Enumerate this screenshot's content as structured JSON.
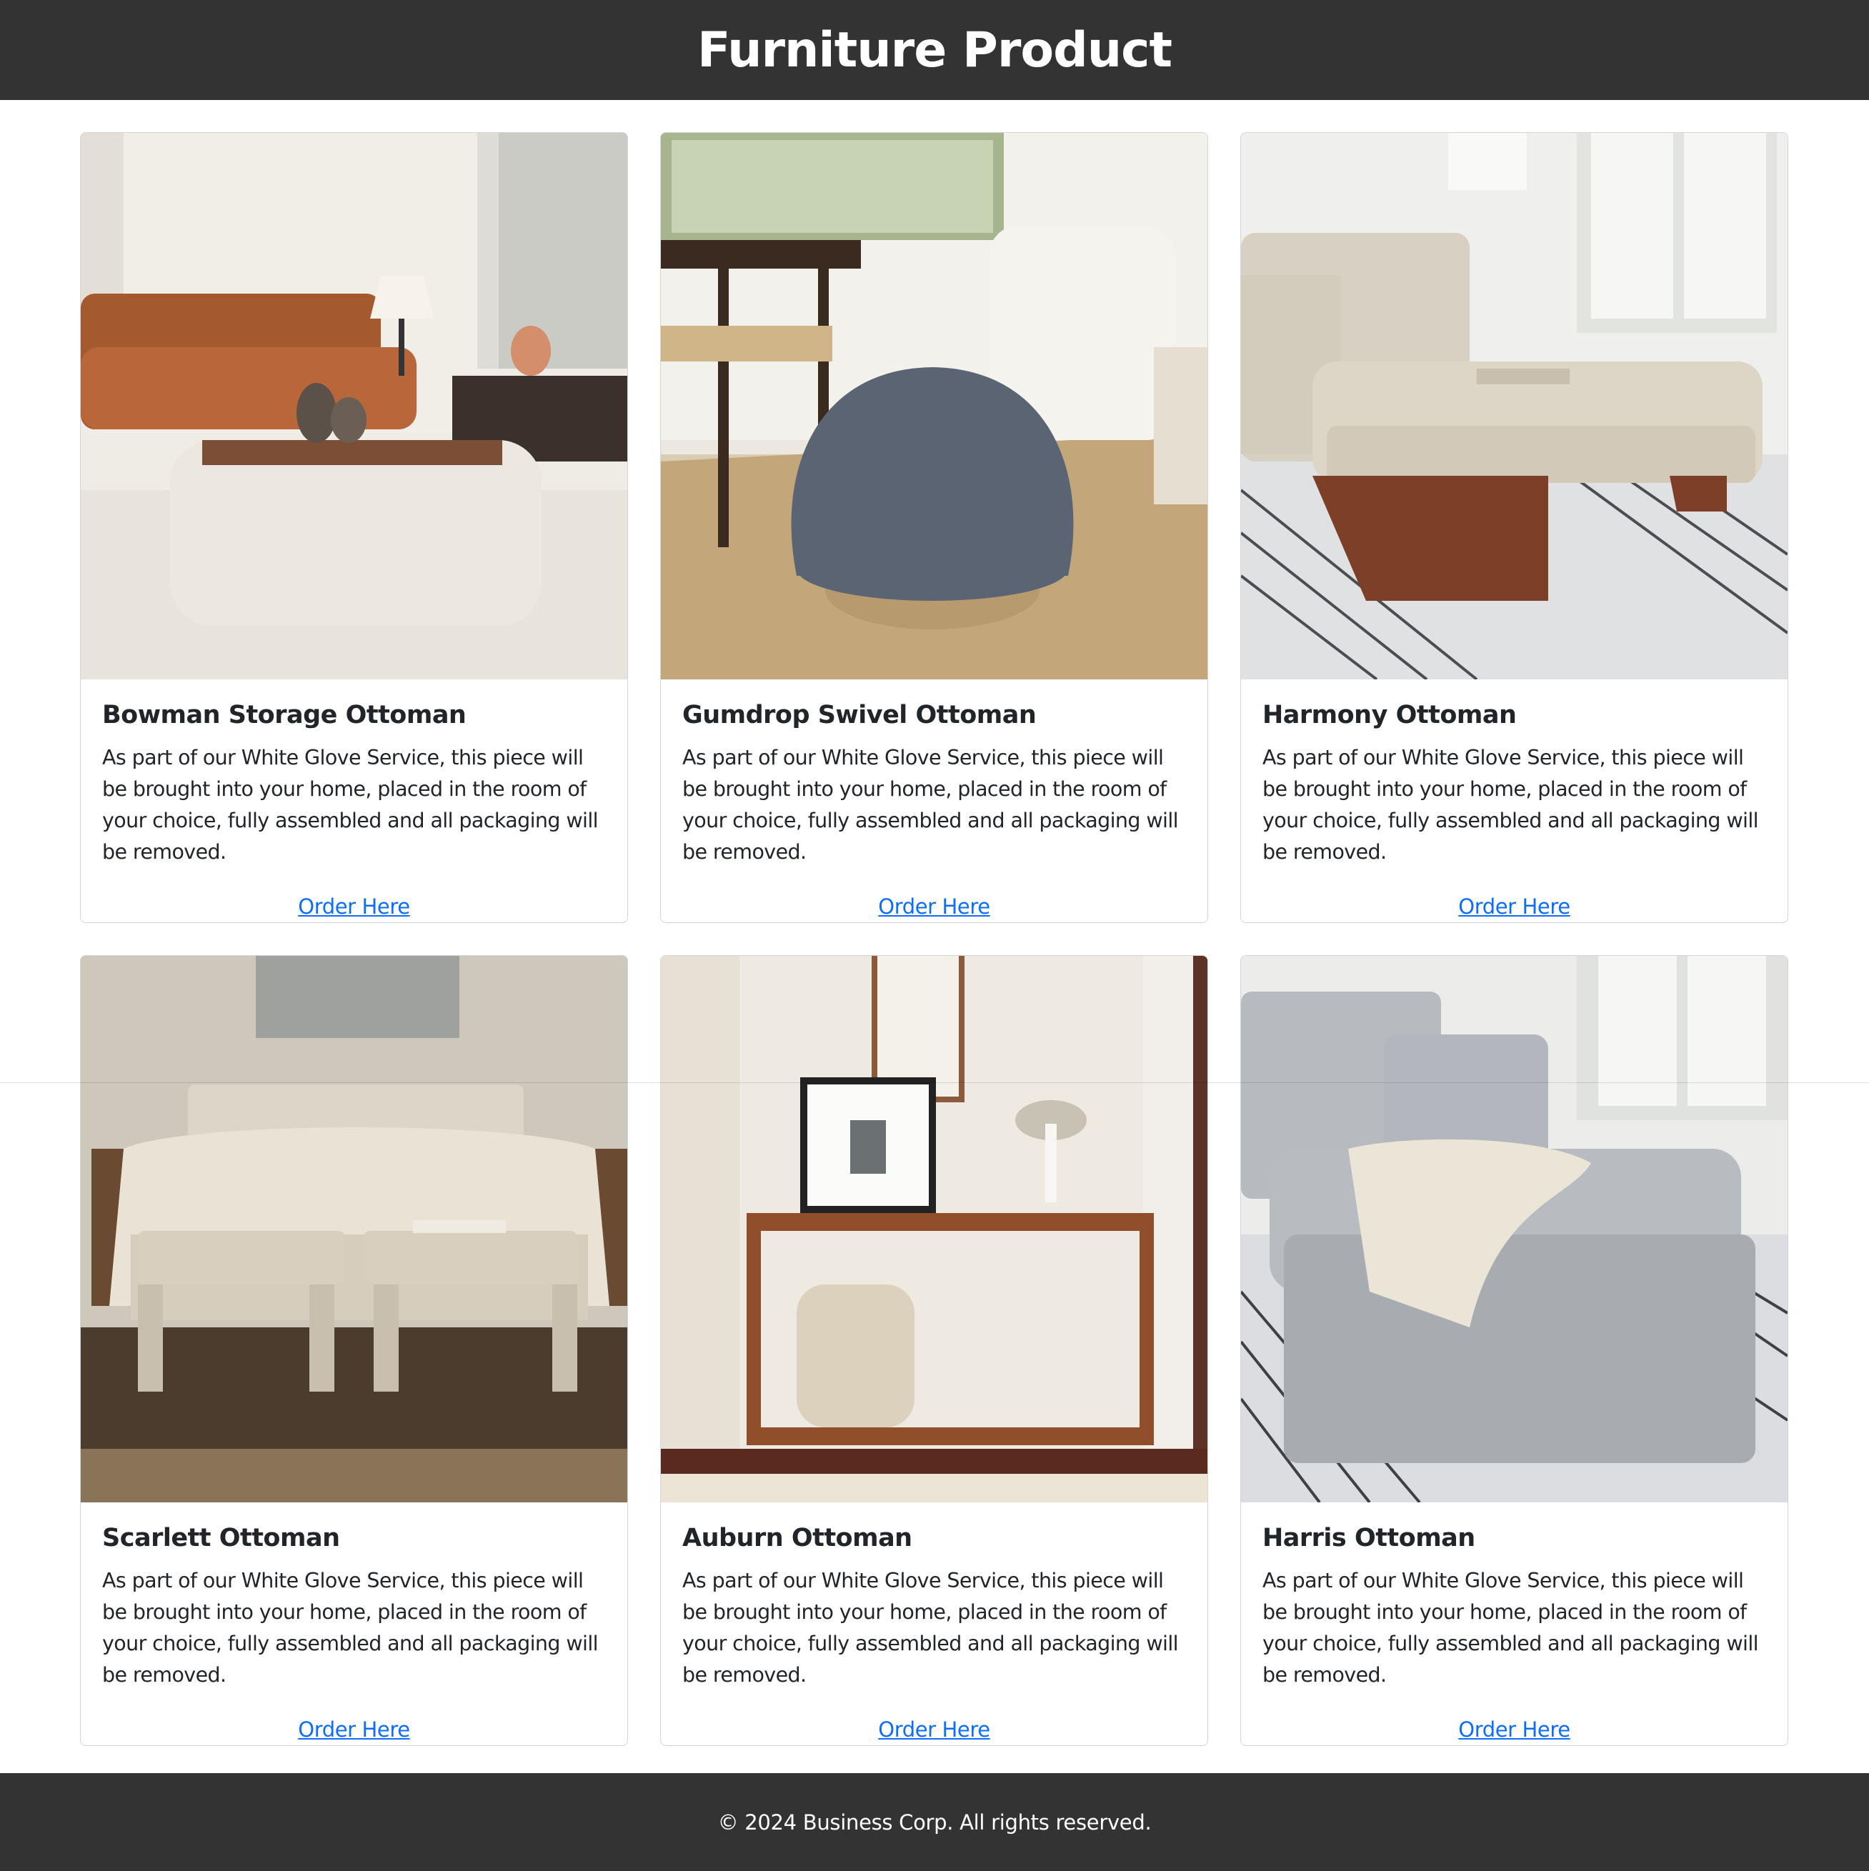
{
  "header": {
    "title": "Furniture Product"
  },
  "products": [
    {
      "name": "Bowman Storage Ottoman",
      "description": "As part of our White Glove Service, this piece will be brought into your home, placed in the room of your choice, fully assembled and all packaging will be removed.",
      "link_label": "Order Here"
    },
    {
      "name": "Gumdrop Swivel Ottoman",
      "description": "As part of our White Glove Service, this piece will be brought into your home, placed in the room of your choice, fully assembled and all packaging will be removed.",
      "link_label": "Order Here"
    },
    {
      "name": "Harmony Ottoman",
      "description": "As part of our White Glove Service, this piece will be brought into your home, placed in the room of your choice, fully assembled and all packaging will be removed.",
      "link_label": "Order Here"
    },
    {
      "name": "Scarlett Ottoman",
      "description": "As part of our White Glove Service, this piece will be brought into your home, placed in the room of your choice, fully assembled and all packaging will be removed.",
      "link_label": "Order Here"
    },
    {
      "name": "Auburn Ottoman",
      "description": "As part of our White Glove Service, this piece will be brought into your home, placed in the room of your choice, fully assembled and all packaging will be removed.",
      "link_label": "Order Here"
    },
    {
      "name": "Harris Ottoman",
      "description": "As part of our White Glove Service, this piece will be brought into your home, placed in the room of your choice, fully assembled and all packaging will be removed.",
      "link_label": "Order Here"
    }
  ],
  "footer": {
    "copyright": "© 2024 Business Corp. All rights reserved."
  },
  "colors": {
    "header_bg": "#333333",
    "footer_bg": "#333333",
    "link": "#0d6efd"
  }
}
